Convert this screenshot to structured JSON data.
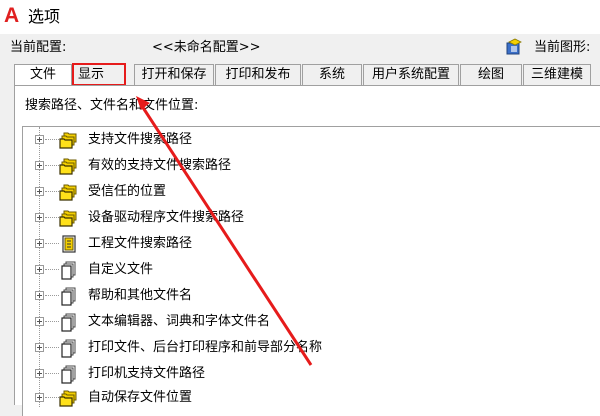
{
  "window": {
    "title": "选项"
  },
  "config": {
    "label": "当前配置:",
    "value": "<<未命名配置>>",
    "drawing_label": "当前图形:"
  },
  "tabs": [
    {
      "label": "文件"
    },
    {
      "label": "显示"
    },
    {
      "label": "打开和保存"
    },
    {
      "label": "打印和发布"
    },
    {
      "label": "系统"
    },
    {
      "label": "用户系统配置"
    },
    {
      "label": "绘图"
    },
    {
      "label": "三维建模"
    }
  ],
  "panel": {
    "heading": "搜索路径、文件名和文件位置:"
  },
  "tree": {
    "items": [
      {
        "label": "支持文件搜索路径",
        "icon": "folder-stack-icon"
      },
      {
        "label": "有效的支持文件搜索路径",
        "icon": "folder-stack-icon"
      },
      {
        "label": "受信任的位置",
        "icon": "folder-stack-icon"
      },
      {
        "label": "设备驱动程序文件搜索路径",
        "icon": "folder-stack-icon"
      },
      {
        "label": "工程文件搜索路径",
        "icon": "project-file-icon"
      },
      {
        "label": "自定义文件",
        "icon": "document-stack-icon"
      },
      {
        "label": "帮助和其他文件名",
        "icon": "document-stack-icon"
      },
      {
        "label": "文本编辑器、词典和字体文件名",
        "icon": "document-stack-icon"
      },
      {
        "label": "打印文件、后台打印程序和前导部分名称",
        "icon": "document-stack-icon"
      },
      {
        "label": "打印机支持文件路径",
        "icon": "document-stack-icon"
      },
      {
        "label": "自动保存文件位置",
        "icon": "folder-stack-icon"
      }
    ]
  },
  "colors": {
    "annotation": "#e61b1b",
    "folder": "#f5d000",
    "app_logo": "#e02020"
  }
}
